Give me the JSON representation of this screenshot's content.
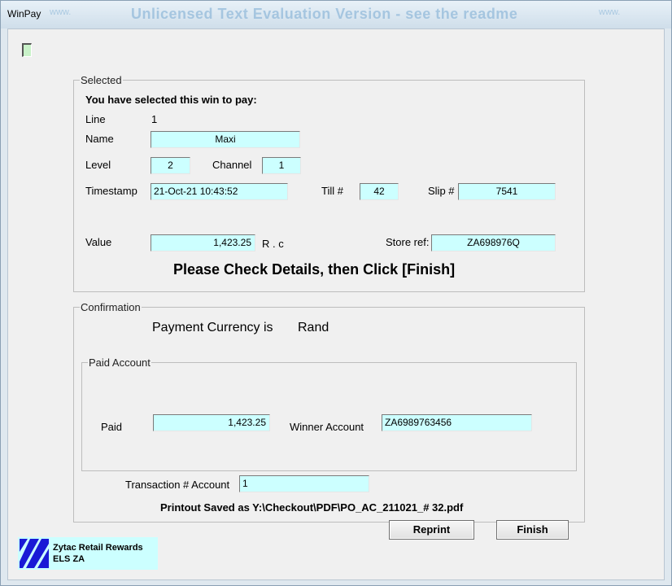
{
  "window": {
    "title": "WinPay",
    "watermark": "Unlicensed Text Evaluation Version - see the readme",
    "watermark_left": "www.",
    "watermark_right": "www."
  },
  "selected": {
    "legend": "Selected",
    "heading": "You have selected this win to pay:",
    "line_label": "Line",
    "line_value": "1",
    "name_label": "Name",
    "name_value": "Maxi",
    "level_label": "Level",
    "level_value": "2",
    "channel_label": "Channel",
    "channel_value": "1",
    "timestamp_label": "Timestamp",
    "timestamp_value": "21-Oct-21 10:43:52",
    "till_label": "Till #",
    "till_value": "42",
    "slip_label": "Slip #",
    "slip_value": "7541",
    "value_label": "Value",
    "value_value": "1,423.25",
    "currency_suffix": "R . c",
    "store_ref_label": "Store ref:",
    "store_ref_value": "ZA698976Q",
    "instruction": "Please Check Details, then Click [Finish]"
  },
  "confirmation": {
    "legend": "Confirmation",
    "payment_currency_label": "Payment Currency is",
    "payment_currency_value": "Rand",
    "paid_account_legend": "Paid Account",
    "paid_label": "Paid",
    "paid_value": "1,423.25",
    "winner_account_label": "Winner Account",
    "winner_account_value": "ZA6989763456",
    "transaction_label": "Transaction # Account",
    "transaction_value": "1",
    "printout_text": "Printout Saved as Y:\\Checkout\\PDF\\PO_AC_211021_# 32.pdf"
  },
  "buttons": {
    "reprint": "Reprint",
    "finish": "Finish"
  },
  "logo": {
    "line1": "Zytac Retail Rewards",
    "line2": "ELS  ZA"
  },
  "colors": {
    "field_bg": "#ccffff",
    "window_bg": "#f0f0f0",
    "logo_blue": "#1a1ad6"
  }
}
